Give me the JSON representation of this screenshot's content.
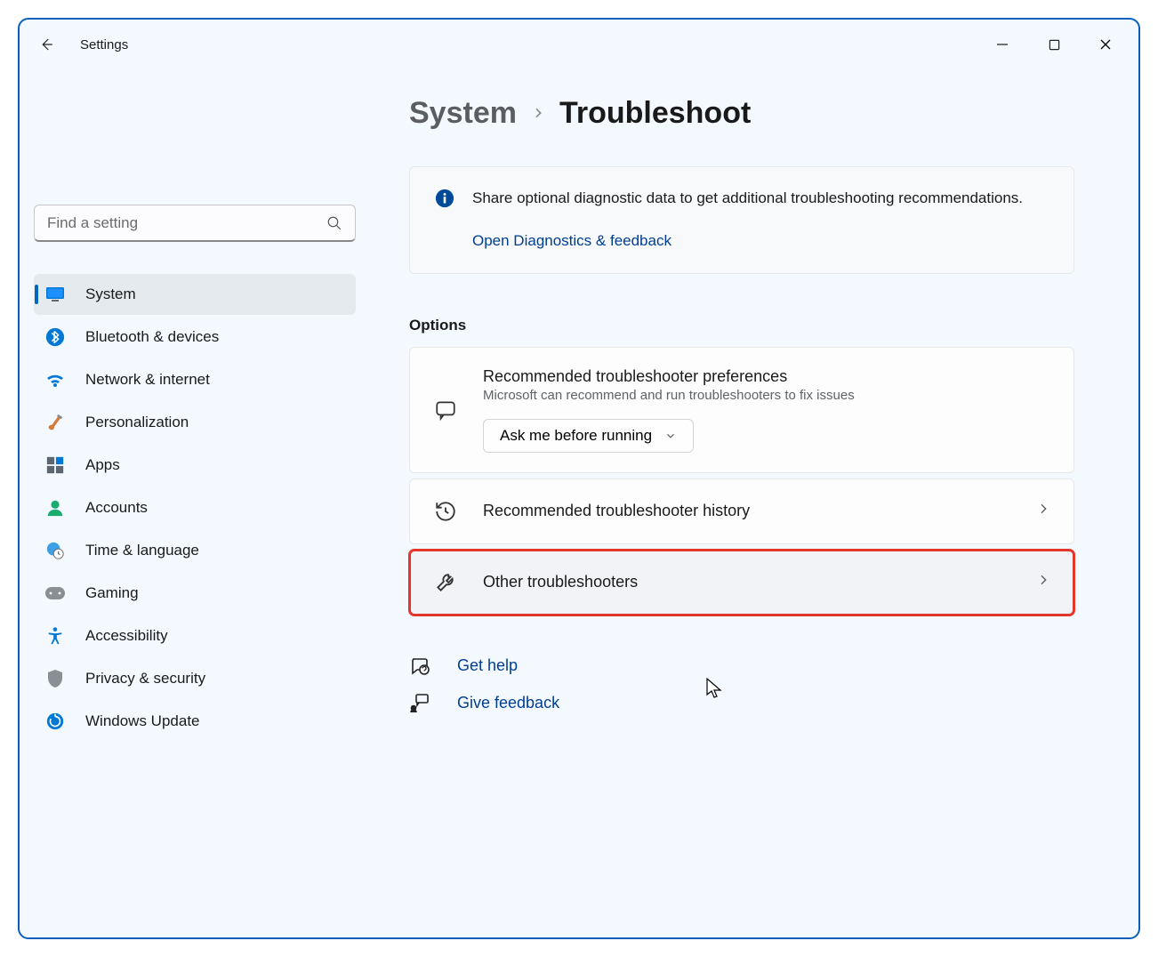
{
  "app_title": "Settings",
  "search": {
    "placeholder": "Find a setting"
  },
  "sidebar": {
    "items": [
      {
        "label": "System",
        "icon": "monitor"
      },
      {
        "label": "Bluetooth & devices",
        "icon": "bluetooth"
      },
      {
        "label": "Network & internet",
        "icon": "wifi"
      },
      {
        "label": "Personalization",
        "icon": "brush"
      },
      {
        "label": "Apps",
        "icon": "apps"
      },
      {
        "label": "Accounts",
        "icon": "person"
      },
      {
        "label": "Time & language",
        "icon": "globe-clock"
      },
      {
        "label": "Gaming",
        "icon": "gamepad"
      },
      {
        "label": "Accessibility",
        "icon": "accessibility"
      },
      {
        "label": "Privacy & security",
        "icon": "shield"
      },
      {
        "label": "Windows Update",
        "icon": "update"
      }
    ],
    "active_index": 0
  },
  "breadcrumb": {
    "parent": "System",
    "current": "Troubleshoot"
  },
  "info_banner": {
    "text": "Share optional diagnostic data to get additional troubleshooting recommendations.",
    "link_label": "Open Diagnostics & feedback"
  },
  "section_title": "Options",
  "option_cards": {
    "preferences": {
      "title": "Recommended troubleshooter preferences",
      "subtitle": "Microsoft can recommend and run troubleshooters to fix issues",
      "selected_option": "Ask me before running"
    },
    "history": {
      "title": "Recommended troubleshooter history"
    },
    "other": {
      "title": "Other troubleshooters"
    }
  },
  "help": {
    "get_help": "Get help",
    "give_feedback": "Give feedback"
  }
}
